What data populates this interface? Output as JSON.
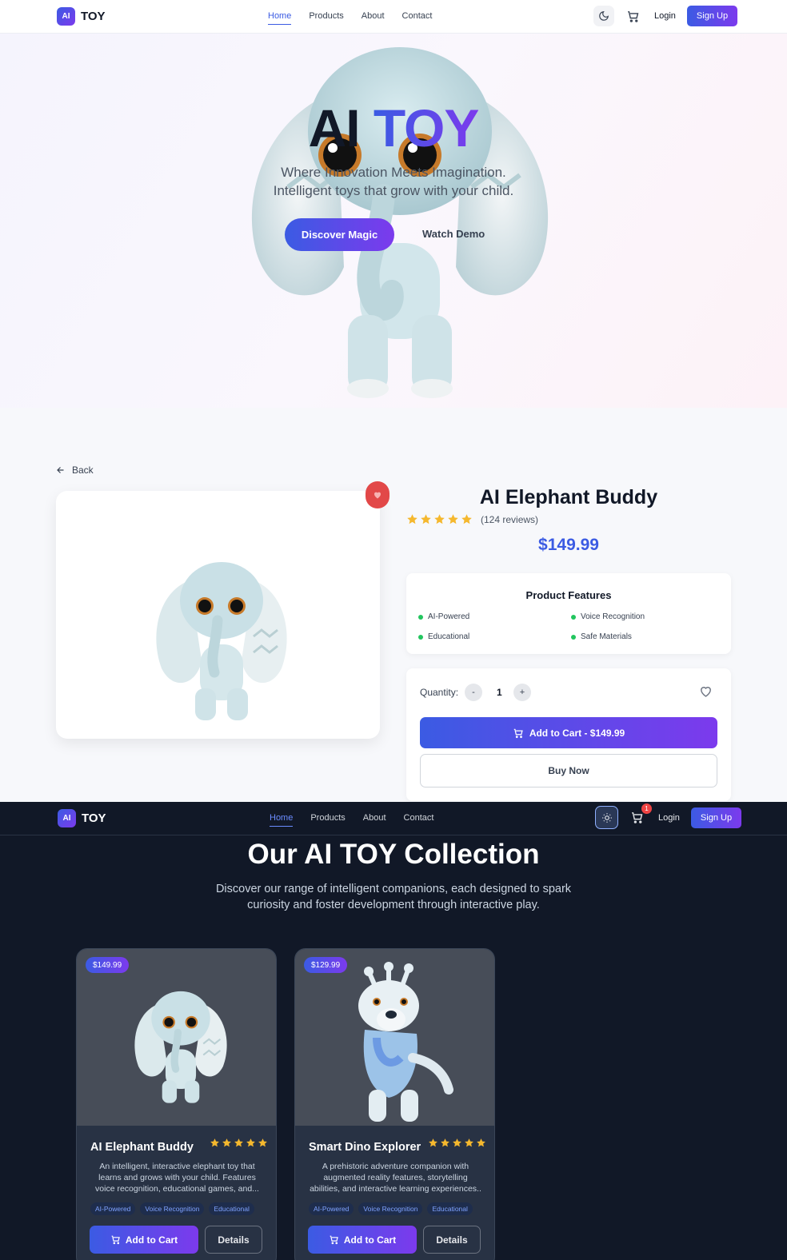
{
  "nav": {
    "logo_badge": "AI",
    "logo_text": "TOY",
    "links": [
      "Home",
      "Products",
      "About",
      "Contact"
    ],
    "active_link": "Home",
    "login": "Login",
    "signup": "Sign Up",
    "cart_count": "1"
  },
  "hero": {
    "title_part1": "AI",
    "title_part2": "TOY",
    "subtitle_line1": "Where Innovation Meets Imagination.",
    "subtitle_line2": "Intelligent toys that grow with your child.",
    "primary_cta": "Discover Magic",
    "secondary_cta": "Watch Demo"
  },
  "product": {
    "back": "Back",
    "name": "AI Elephant Buddy",
    "rating": 5,
    "reviews": "(124 reviews)",
    "price": "$149.99",
    "features_title": "Product Features",
    "features": [
      "AI-Powered",
      "Voice Recognition",
      "Educational",
      "Safe Materials"
    ],
    "quantity_label": "Quantity:",
    "quantity_minus": "-",
    "quantity_value": "1",
    "quantity_plus": "+",
    "add_to_cart": "Add to Cart - $149.99",
    "buy_now": "Buy Now"
  },
  "collection": {
    "title": "Our AI TOY Collection",
    "subtitle": "Discover our range of intelligent companions, each designed to spark curiosity and foster development through interactive play.",
    "cards": [
      {
        "price": "$149.99",
        "name": "AI Elephant Buddy",
        "rating": 5,
        "description": "An intelligent, interactive elephant toy that learns and grows with your child. Features voice recognition, educational games, and...",
        "tags": [
          "AI-Powered",
          "Voice Recognition",
          "Educational"
        ],
        "add_to_cart": "Add to Cart",
        "details": "Details"
      },
      {
        "price": "$129.99",
        "name": "Smart Dino Explorer",
        "rating": 5,
        "description": "A prehistoric adventure companion with augmented reality features, storytelling abilities, and interactive learning experiences..",
        "tags": [
          "AI-Powered",
          "Voice Recognition",
          "Educational"
        ],
        "add_to_cart": "Add to Cart",
        "details": "Details"
      }
    ]
  },
  "colors": {
    "brand_blue": "#3b5be3",
    "brand_purple": "#7c3aed",
    "star": "#f5b82e",
    "feature_dot": "#22c55e",
    "dark_bg": "#111827"
  }
}
